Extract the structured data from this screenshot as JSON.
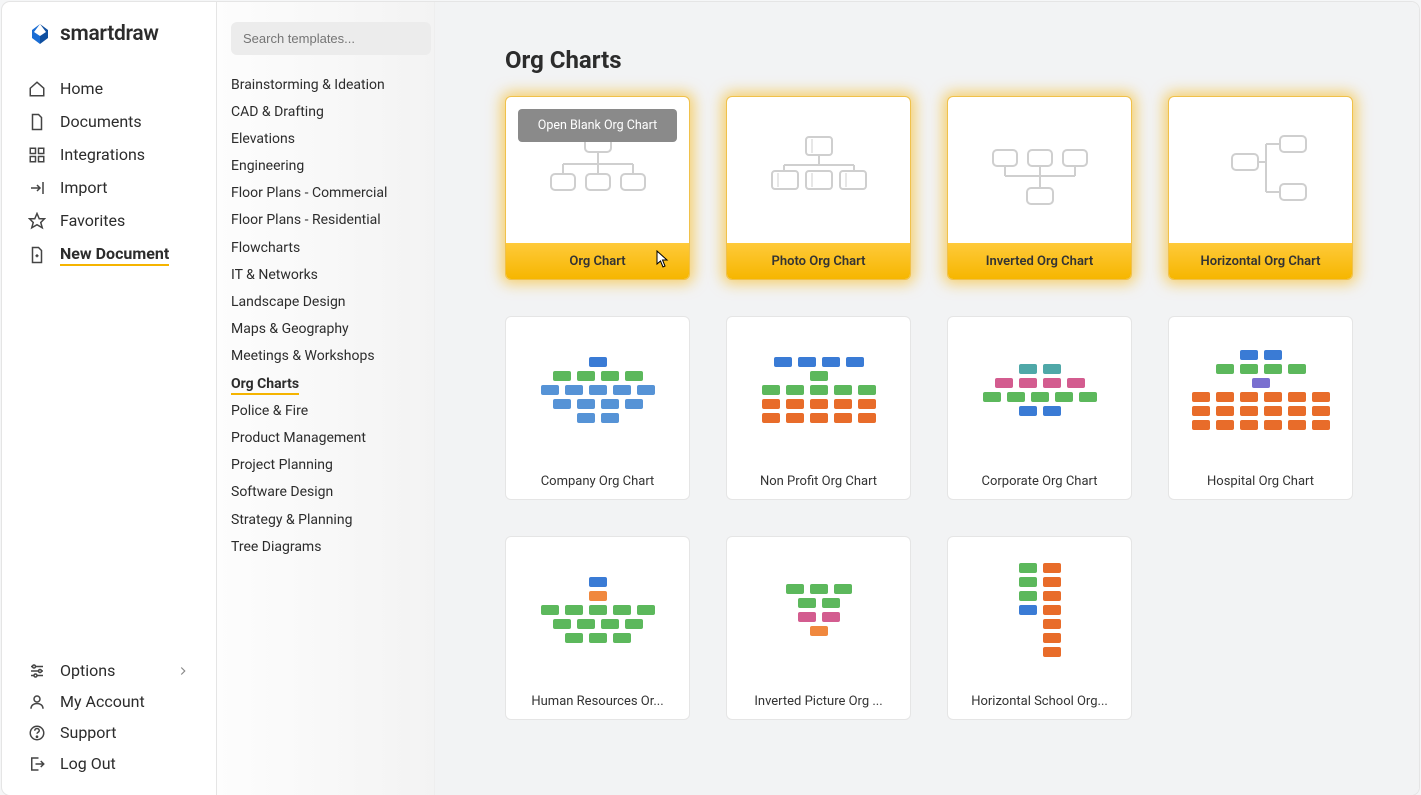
{
  "brand": {
    "name": "smartdraw"
  },
  "sidebar": {
    "items": [
      {
        "label": "Home",
        "icon": "home-icon"
      },
      {
        "label": "Documents",
        "icon": "document-icon"
      },
      {
        "label": "Integrations",
        "icon": "integrations-icon"
      },
      {
        "label": "Import",
        "icon": "import-icon"
      },
      {
        "label": "Favorites",
        "icon": "star-icon"
      },
      {
        "label": "New Document",
        "icon": "new-doc-icon",
        "active": true
      }
    ],
    "bottom": [
      {
        "label": "Options",
        "icon": "options-icon",
        "chevron": true
      },
      {
        "label": "My Account",
        "icon": "account-icon"
      },
      {
        "label": "Support",
        "icon": "support-icon"
      },
      {
        "label": "Log Out",
        "icon": "logout-icon"
      }
    ]
  },
  "search": {
    "placeholder": "Search templates..."
  },
  "categories": [
    "Brainstorming & Ideation",
    "CAD & Drafting",
    "Elevations",
    "Engineering",
    "Floor Plans - Commercial",
    "Floor Plans - Residential",
    "Flowcharts",
    "IT & Networks",
    "Landscape Design",
    "Maps & Geography",
    "Meetings & Workshops",
    "Org Charts",
    "Police & Fire",
    "Product Management",
    "Project Planning",
    "Software Design",
    "Strategy & Planning",
    "Tree Diagrams"
  ],
  "categories_active_index": 11,
  "page": {
    "title": "Org Charts",
    "open_blank_label": "Open Blank Org Chart",
    "templates": [
      {
        "label": "Org Chart",
        "featured": true,
        "hover": true
      },
      {
        "label": "Photo Org Chart",
        "featured": true
      },
      {
        "label": "Inverted Org Chart",
        "featured": true
      },
      {
        "label": "Horizontal Org Chart",
        "featured": true
      },
      {
        "label": "Company Org Chart"
      },
      {
        "label": "Non Profit Org Chart"
      },
      {
        "label": "Corporate Org Chart"
      },
      {
        "label": "Hospital Org Chart"
      },
      {
        "label": "Human Resources Or..."
      },
      {
        "label": "Inverted Picture Org ..."
      },
      {
        "label": "Horizontal School Org..."
      }
    ]
  }
}
